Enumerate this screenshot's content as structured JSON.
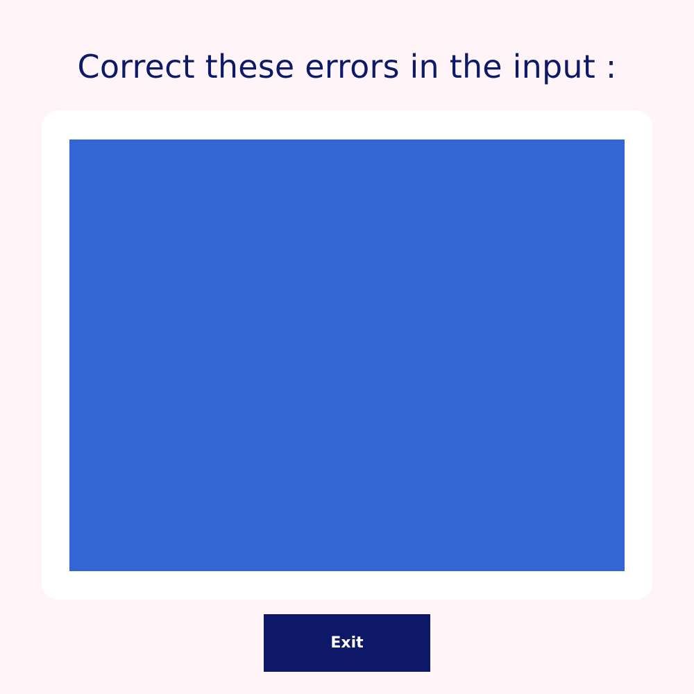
{
  "page": {
    "title": "Correct these errors in the input :"
  },
  "error_panel": {
    "color": "#3366d4"
  },
  "actions": {
    "exit_label": "Exit"
  },
  "colors": {
    "background": "#fff4f7",
    "title_text": "#0d1a68",
    "card": "#ffffff",
    "button": "#0d1868",
    "button_text": "#ffffff"
  }
}
